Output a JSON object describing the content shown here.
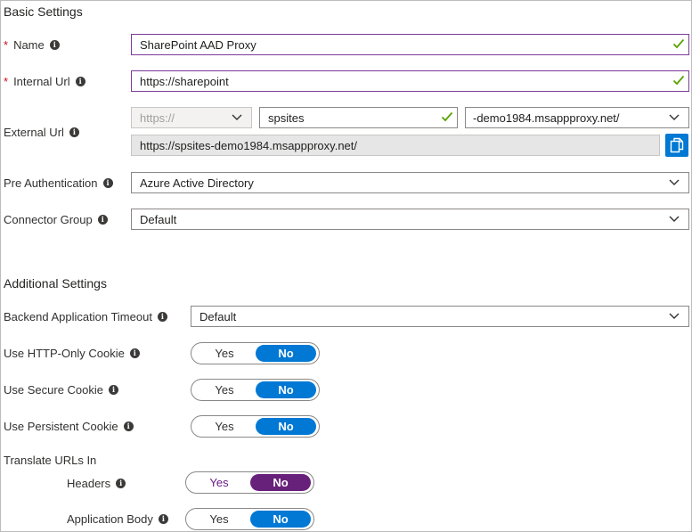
{
  "basic": {
    "title": "Basic Settings",
    "name": {
      "label": "Name",
      "required_mark": "*",
      "value": "SharePoint AAD Proxy"
    },
    "internal_url": {
      "label": "Internal Url",
      "required_mark": "*",
      "value": "https://sharepoint"
    },
    "external_url": {
      "label": "External Url",
      "scheme": "https://",
      "subdomain": "spsites",
      "domain": "-demo1984.msappproxy.net/",
      "full": "https://spsites-demo1984.msappproxy.net/"
    },
    "pre_auth": {
      "label": "Pre Authentication",
      "value": "Azure Active Directory"
    },
    "connector_group": {
      "label": "Connector Group",
      "value": "Default"
    }
  },
  "additional": {
    "title": "Additional Settings",
    "backend_timeout": {
      "label": "Backend Application Timeout",
      "value": "Default"
    },
    "http_only_cookie": {
      "label": "Use HTTP-Only Cookie",
      "yes": "Yes",
      "no": "No",
      "selected": "No"
    },
    "secure_cookie": {
      "label": "Use Secure Cookie",
      "yes": "Yes",
      "no": "No",
      "selected": "No"
    },
    "persistent_cookie": {
      "label": "Use Persistent Cookie",
      "yes": "Yes",
      "no": "No",
      "selected": "No"
    },
    "translate_urls": {
      "label": "Translate URLs In",
      "headers": {
        "label": "Headers",
        "yes": "Yes",
        "no": "No",
        "selected": "No"
      },
      "app_body": {
        "label": "Application Body",
        "yes": "Yes",
        "no": "No",
        "selected": "No"
      }
    }
  },
  "icons": {
    "info": "info-icon",
    "valid": "checkmark-icon",
    "dropdown": "chevron-down-icon",
    "copy": "copy-icon"
  },
  "colors": {
    "accent": "#0078d4",
    "focus_border": "#7a3b9a",
    "valid_check": "#57a300",
    "required": "#c50f1f",
    "headers_toggle": "#68217a"
  }
}
